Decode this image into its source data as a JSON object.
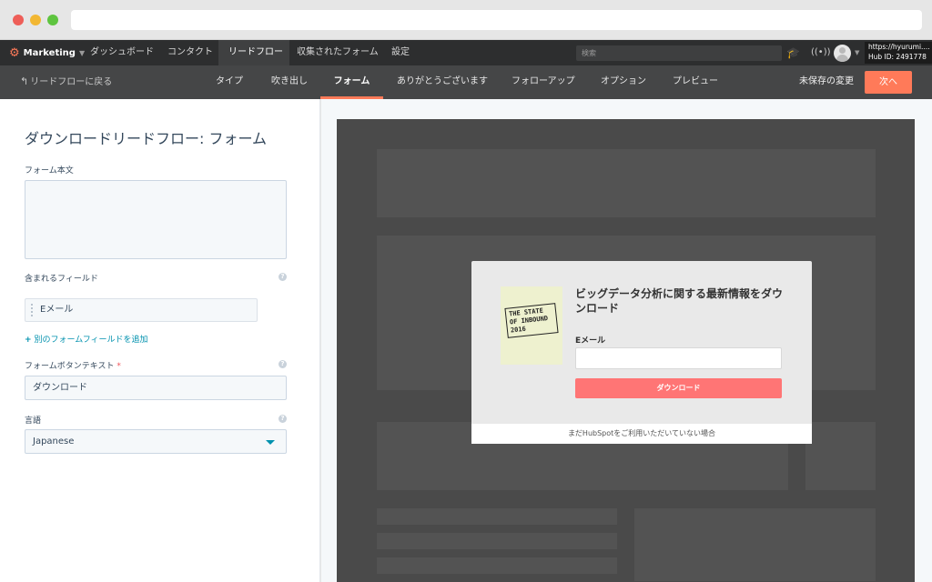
{
  "topnav": {
    "brand": "Marketing",
    "items": [
      "ダッシュボード",
      "コンタクト",
      "リードフロー",
      "収集されたフォーム",
      "設定"
    ],
    "active_item": "リードフロー",
    "search_placeholder": "検索",
    "account_url": "https://hyurumi....",
    "hub_id": "Hub ID: 2491778"
  },
  "subnav": {
    "back_label": "リードフローに戻る",
    "tabs": [
      "タイプ",
      "吹き出し",
      "フォーム",
      "ありがとうございます",
      "フォローアップ",
      "オプション",
      "プレビュー"
    ],
    "active_tab": "フォーム",
    "unsaved_label": "未保存の変更",
    "next_label": "次へ"
  },
  "editor": {
    "title": "ダウンロードリードフロー: フォーム",
    "form_body_label": "フォーム本文",
    "form_body_value": "",
    "fields_label": "含まれるフィールド",
    "field_items": [
      "Eメール"
    ],
    "add_field_label": "別のフォームフィールドを追加",
    "button_text_label": "フォームボタンテキスト",
    "button_text_required": "*",
    "button_text_value": "ダウンロード",
    "language_label": "言語",
    "language_value": "Japanese"
  },
  "preview": {
    "cover_text": "THE STATE OF INBOUND 2016",
    "title": "ビッグデータ分析に関する最新情報をダウンロード",
    "email_label": "Eメール",
    "email_value": "",
    "button_label": "ダウンロード",
    "footer_text": "まだHubSpotをご利用いただいていない場合"
  },
  "colors": {
    "accent": "#ff7a59",
    "link": "#0091ae",
    "preview_button": "#ff7575"
  }
}
